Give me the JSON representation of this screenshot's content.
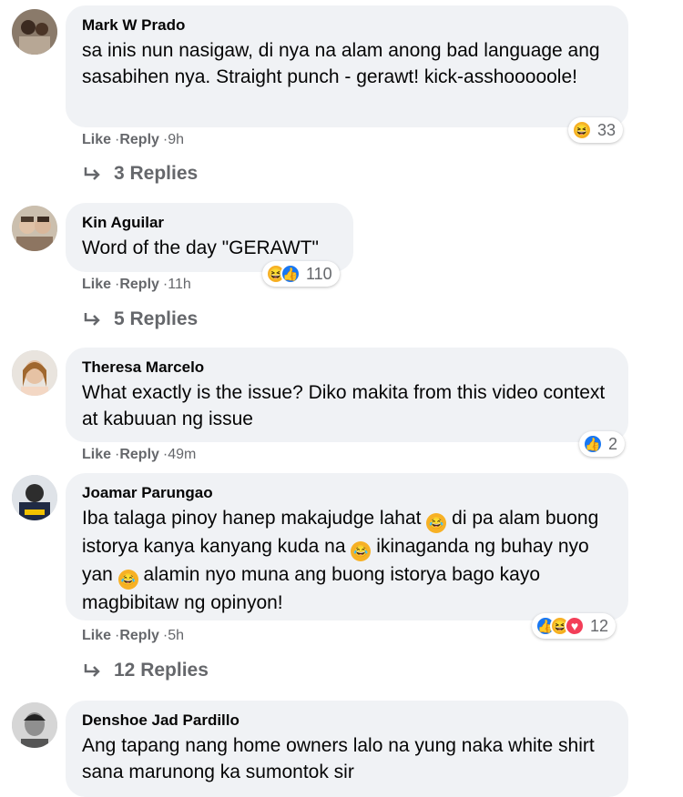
{
  "comments": [
    {
      "name": "Mark W Prado",
      "text": "sa inis nun nasigaw, di nya na alam anong bad language ang sasabihen nya. Straight punch - gerawt! kick-asshooooole!",
      "like": "Like",
      "reply": "Reply",
      "time": "9h",
      "reaction_count": "33",
      "replies": "3 Replies"
    },
    {
      "name": "Kin Aguilar",
      "text": "Word of the day \"GERAWT\"",
      "like": "Like",
      "reply": "Reply",
      "time": "11h",
      "reaction_count": "110",
      "replies": "5 Replies"
    },
    {
      "name": "Theresa Marcelo",
      "text": "What exactly is the issue? Diko makita from this video context at kabuuan ng issue",
      "like": "Like",
      "reply": "Reply",
      "time": "49m",
      "reaction_count": "2"
    },
    {
      "name": "Joamar Parungao",
      "text_parts": [
        "Iba talaga pinoy hanep makajudge lahat",
        "di pa alam buong istorya kanya kanyang kuda na",
        "ikinaganda ng buhay nyo yan",
        "alamin nyo muna ang buong istorya bago kayo magbibitaw ng opinyon!"
      ],
      "like": "Like",
      "reply": "Reply",
      "time": "5h",
      "reaction_count": "12",
      "replies": "12 Replies"
    },
    {
      "name": "Denshoe Jad Pardillo",
      "text": "Ang tapang nang home owners lalo na yung naka white shirt sana marunong ka sumontok sir"
    }
  ],
  "colors": {
    "bubble": "#f0f2f5",
    "secondary_text": "#65676b",
    "like_blue": "#1877f2",
    "haha_yellow": "#f7b125",
    "love_red": "#f33e58"
  }
}
